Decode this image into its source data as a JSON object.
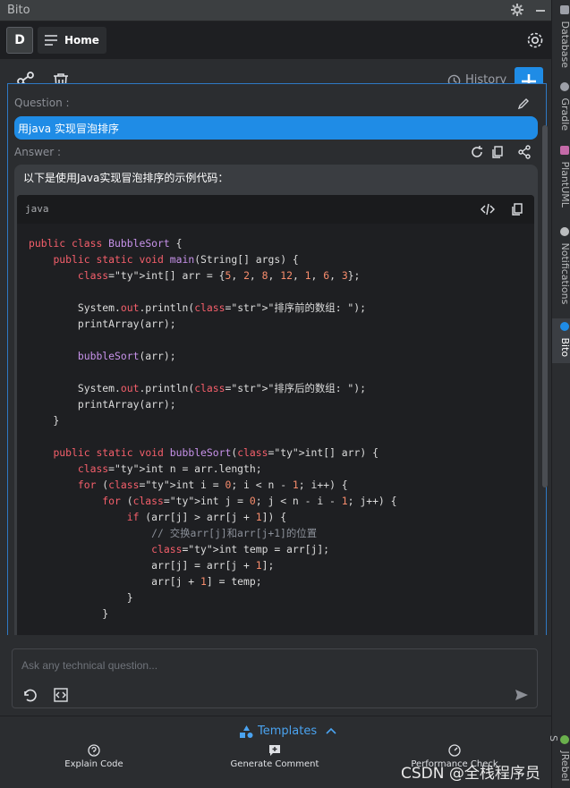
{
  "window": {
    "title": "Bito"
  },
  "tabbar": {
    "avatar": "D",
    "home_label": "Home"
  },
  "toolbar": {
    "history_label": "History"
  },
  "conversation": {
    "question_label": "Question :",
    "question_text": "用java 实现冒泡排序",
    "answer_label": "Answer :",
    "answer_intro": "以下是使用Java实现冒泡排序的示例代码：",
    "code_lang": "java",
    "code_lines": [
      "public class BubbleSort {",
      "    public static void main(String[] args) {",
      "        int[] arr = {5, 2, 8, 12, 1, 6, 3};",
      "",
      "        System.out.println(\"排序前的数组: \");",
      "        printArray(arr);",
      "",
      "        bubbleSort(arr);",
      "",
      "        System.out.println(\"排序后的数组: \");",
      "        printArray(arr);",
      "    }",
      "",
      "    public static void bubbleSort(int[] arr) {",
      "        int n = arr.length;",
      "        for (int i = 0; i < n - 1; i++) {",
      "            for (int j = 0; j < n - i - 1; j++) {",
      "                if (arr[j] > arr[j + 1]) {",
      "                    // 交换arr[j]和arr[j+1]的位置",
      "                    int temp = arr[j];",
      "                    arr[j] = arr[j + 1];",
      "                    arr[j + 1] = temp;",
      "                }",
      "            }"
    ]
  },
  "input": {
    "placeholder": "Ask any technical question..."
  },
  "templates": {
    "label": "Templates",
    "items": [
      {
        "label": "Explain Code",
        "icon": "question-icon"
      },
      {
        "label": "Generate Comment",
        "icon": "comment-plus-icon"
      },
      {
        "label": "Performance Check",
        "icon": "gauge-icon"
      }
    ]
  },
  "sidebar": {
    "tabs": [
      {
        "label": "Database",
        "icon": "database-icon"
      },
      {
        "label": "Gradle",
        "icon": "gradle-icon"
      },
      {
        "label": "PlantUML",
        "icon": "plantuml-icon"
      },
      {
        "label": "Notifications",
        "icon": "bell-icon"
      },
      {
        "label": "Bito",
        "icon": "bito-icon",
        "active": true
      },
      {
        "label": "JRebel S",
        "icon": "jrebel-icon"
      }
    ]
  },
  "watermark": "CSDN @全栈程序员",
  "colors": {
    "accent": "#1f8ce6",
    "background": "#2b2d30",
    "code_bg": "#1e1f22"
  }
}
